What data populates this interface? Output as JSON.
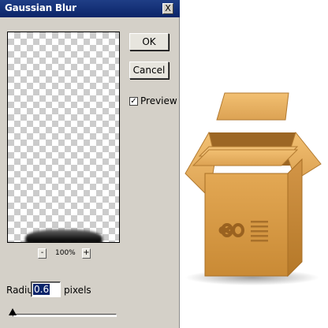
{
  "dialog": {
    "title": "Gaussian Blur",
    "close_label": "X",
    "ok_label": "OK",
    "cancel_label": "Cancel",
    "preview_checked_mark": "✓",
    "preview_label": "Preview",
    "zoom": {
      "minus_label": "-",
      "value": "100%",
      "plus_label": "+"
    },
    "radius": {
      "label": "Radius:",
      "value": "0.6",
      "units": "pixels"
    },
    "slider_fraction": 0.0
  },
  "icons": {
    "close": "close-icon",
    "checkbox": "checkbox-checked-icon",
    "box": "open-cardboard-box-icon"
  },
  "colors": {
    "dialog_bg": "#d4d0c8",
    "titlebar": "#0b2468",
    "selection": "#0a246a",
    "box_tan": "#e0a24c"
  }
}
